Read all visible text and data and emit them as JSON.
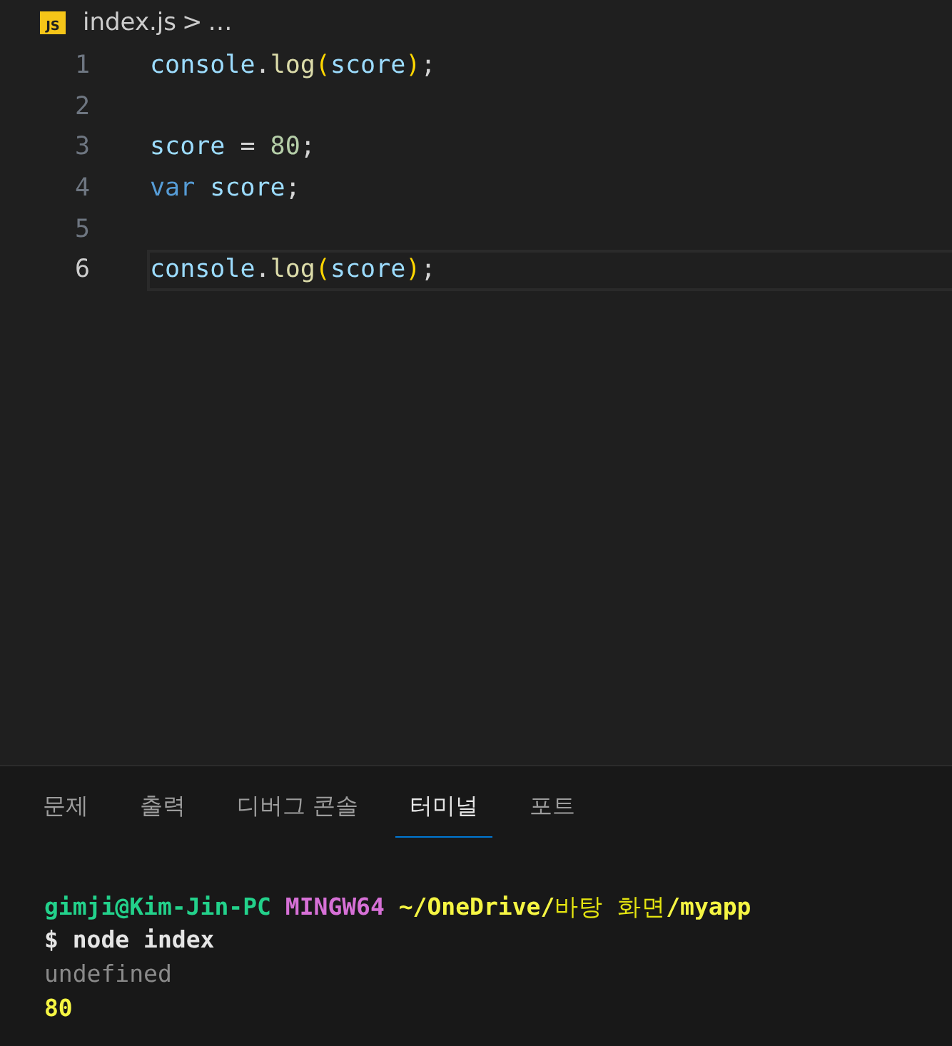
{
  "breadcrumb": {
    "file_badge": "JS",
    "file": "index.js",
    "separator": ">",
    "more": "…"
  },
  "editor": {
    "lines": [
      {
        "number": "1",
        "current": false,
        "tokens": [
          {
            "text": "console",
            "kind": "var"
          },
          {
            "text": ".",
            "kind": "plain"
          },
          {
            "text": "log",
            "kind": "fn"
          },
          {
            "text": "(",
            "kind": "paren"
          },
          {
            "text": "score",
            "kind": "var"
          },
          {
            "text": ")",
            "kind": "paren"
          },
          {
            "text": ";",
            "kind": "plain"
          }
        ]
      },
      {
        "number": "2",
        "current": false
      },
      {
        "number": "3",
        "current": false,
        "tokens": [
          {
            "text": "score",
            "kind": "var"
          },
          {
            "text": " = ",
            "kind": "plain"
          },
          {
            "text": "80",
            "kind": "num"
          },
          {
            "text": ";",
            "kind": "plain"
          }
        ]
      },
      {
        "number": "4",
        "current": false,
        "tokens": [
          {
            "text": "var ",
            "kind": "keyword"
          },
          {
            "text": "score",
            "kind": "var"
          },
          {
            "text": ";",
            "kind": "plain"
          }
        ]
      },
      {
        "number": "5",
        "current": false
      },
      {
        "number": "6",
        "current": true,
        "tokens": [
          {
            "text": "console",
            "kind": "var"
          },
          {
            "text": ".",
            "kind": "plain"
          },
          {
            "text": "log",
            "kind": "fn"
          },
          {
            "text": "(",
            "kind": "paren"
          },
          {
            "text": "score",
            "kind": "var"
          },
          {
            "text": ")",
            "kind": "paren"
          },
          {
            "text": ";",
            "kind": "plain"
          }
        ]
      }
    ]
  },
  "panel": {
    "tabs": [
      {
        "label": "문제",
        "selected": false
      },
      {
        "label": "출력",
        "selected": false
      },
      {
        "label": "디버그 콘솔",
        "selected": false
      },
      {
        "label": "터미널",
        "selected": true
      },
      {
        "label": "포트",
        "selected": false
      }
    ],
    "terminal": {
      "lines": [
        {
          "segments": [
            {
              "text": "gimji@Kim-Jin-PC ",
              "kind": "user"
            },
            {
              "text": "MINGW64 ",
              "kind": "host"
            },
            {
              "text": "~/OneDrive/",
              "kind": "path"
            },
            {
              "text": "바탕 화면",
              "kind": "pathlight"
            },
            {
              "text": "/myapp",
              "kind": "path"
            }
          ]
        },
        {
          "segments": [
            {
              "text": "$ node index",
              "kind": "plain"
            }
          ]
        },
        {
          "segments": [
            {
              "text": "undefined",
              "kind": "dim"
            }
          ]
        },
        {
          "segments": [
            {
              "text": "80",
              "kind": "number"
            }
          ]
        }
      ]
    }
  }
}
